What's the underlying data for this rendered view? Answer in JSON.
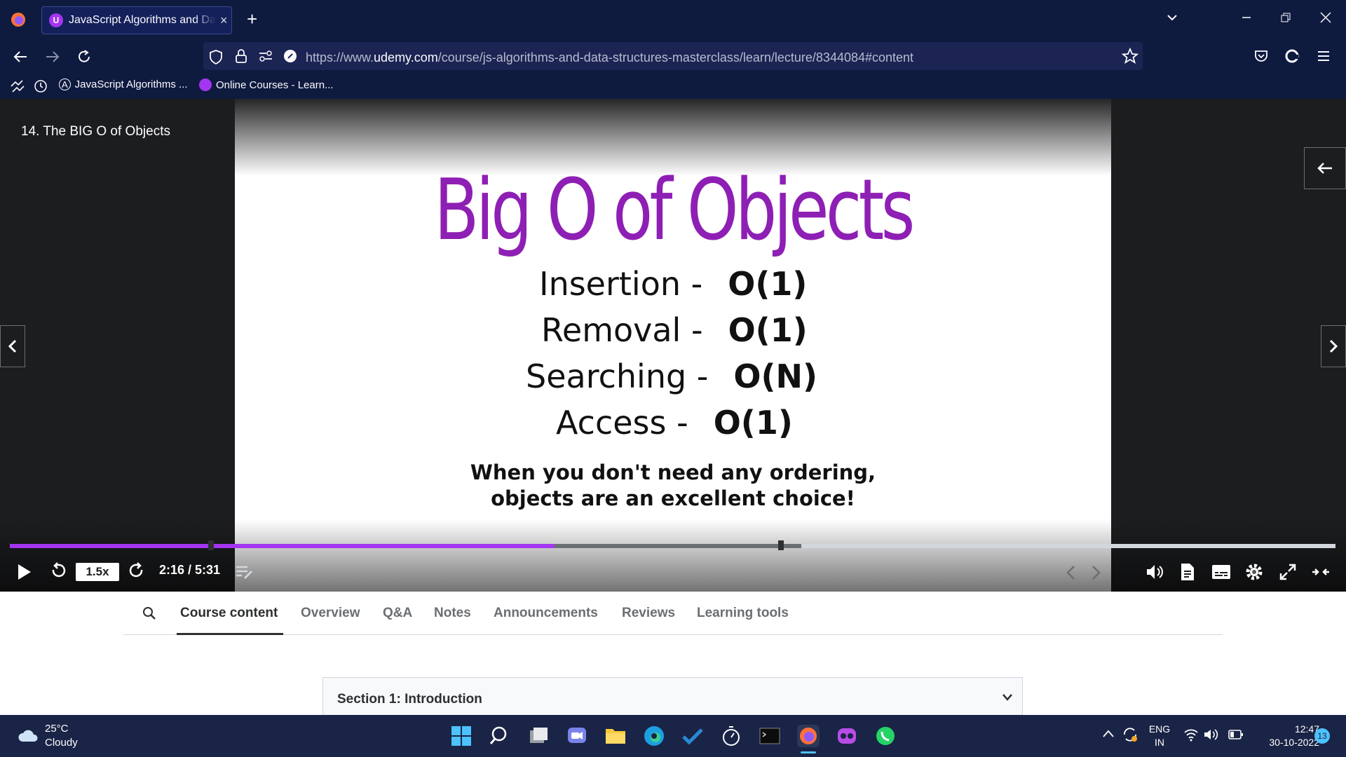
{
  "browser": {
    "tab_title": "JavaScript Algorithms and Data Structures Masterclass",
    "tab_favicon_letter": "U",
    "url_prefix": "https://www.",
    "url_domain": "udemy.com",
    "url_path": "/course/js-algorithms-and-data-structures-masterclass/learn/lecture/8344084#content",
    "bookmarks": [
      "JavaScript Algorithms ...",
      "Online Courses - Learn..."
    ]
  },
  "video": {
    "lecture_title": "14. The BIG O of Objects",
    "slide": {
      "title": "Big O of Objects",
      "rows": [
        {
          "label": "Insertion -",
          "value": "O(1)"
        },
        {
          "label": "Removal -",
          "value": "O(1)"
        },
        {
          "label": "Searching -",
          "value": "O(N)"
        },
        {
          "label": "Access -",
          "value": "O(1)"
        }
      ],
      "note_line1": "When you don't need any ordering,",
      "note_line2": "objects are an excellent choice!"
    },
    "speed": "1.5x",
    "time": "2:16 / 5:31",
    "progress_fraction": 0.411,
    "buffered_fraction": 0.597
  },
  "tabs": {
    "items": [
      "Course content",
      "Overview",
      "Q&A",
      "Notes",
      "Announcements",
      "Reviews",
      "Learning tools"
    ],
    "active": "Course content"
  },
  "section": {
    "title": "Section 1: Introduction"
  },
  "taskbar": {
    "temperature": "25°C",
    "condition": "Cloudy",
    "lang_top": "ENG",
    "lang_bottom": "IN",
    "clock_time": "12:47",
    "clock_date": "30-10-2022",
    "notification_count": "13"
  },
  "colors": {
    "brand_purple": "#a435f0",
    "slide_title_purple": "#8e1fb4",
    "chrome_bg": "#0f1a3f",
    "player_bg": "#1c1d1f"
  }
}
